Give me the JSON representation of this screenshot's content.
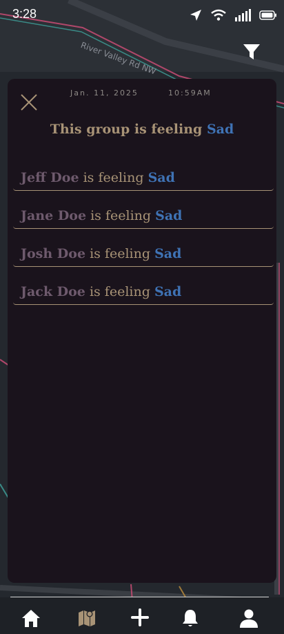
{
  "status_bar": {
    "time": "3:28"
  },
  "map": {
    "street_label": "River Valley Rd NW"
  },
  "modal": {
    "date": "Jan. 11, 2025",
    "time": "10:59AM",
    "title_prefix": "This group is feeling",
    "title_feeling": "Sad",
    "rows": [
      {
        "name": "Jeff Doe",
        "mid": "is feeling",
        "feeling": "Sad"
      },
      {
        "name": "Jane Doe",
        "mid": "is feeling",
        "feeling": "Sad"
      },
      {
        "name": "Josh Doe",
        "mid": "is feeling",
        "feeling": "Sad"
      },
      {
        "name": "Jack Doe",
        "mid": "is feeling",
        "feeling": "Sad"
      }
    ]
  },
  "nav": {
    "items": [
      "home-icon",
      "map-icon",
      "plus-icon",
      "bell-icon",
      "profile-icon"
    ]
  },
  "colors": {
    "modal_bg": "#1a131c",
    "accent_gold": "#a89376",
    "accent_blue": "#3f73b5",
    "name_purple": "#6e5a6d"
  }
}
